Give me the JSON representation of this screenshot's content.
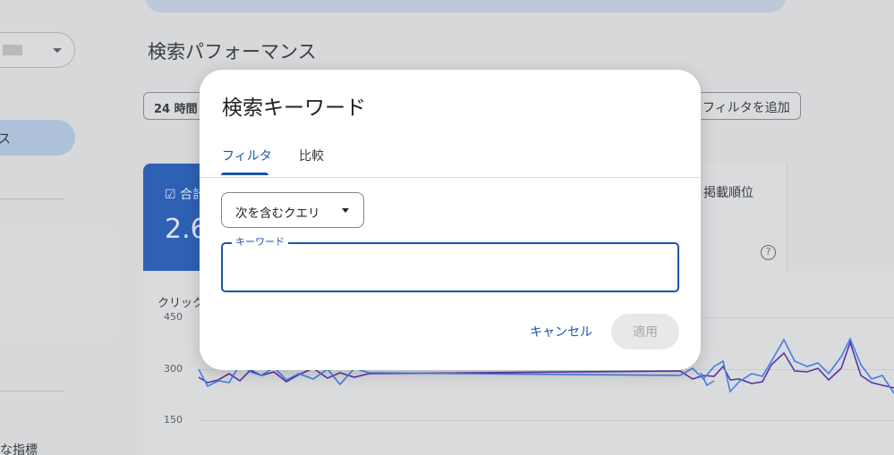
{
  "background": {
    "page_title": "検索パフォーマンス",
    "date_chip": "24 時間",
    "add_filter_chip": "フィルタを追加",
    "nav_active_label": "ス",
    "nav_bottom_label": "な指標",
    "metric_total_label": "合計",
    "metric_total_value": "2.6",
    "metric_position_label": "掲載順位",
    "chart_label": "クリック",
    "y_ticks": [
      "450",
      "300",
      "150"
    ]
  },
  "dialog": {
    "title": "検索キーワード",
    "tabs": [
      {
        "label": "フィルタ",
        "active": true
      },
      {
        "label": "比較",
        "active": false
      }
    ],
    "match_type_select": "次を含むクエリ",
    "keyword_field": {
      "label": "キーワード",
      "value": ""
    },
    "cancel_label": "キャンセル",
    "apply_label": "適用"
  },
  "colors": {
    "accent": "#1a56a8",
    "metric_blue": "#2f64bd",
    "line_clicks": "#4285f4",
    "line_impressions": "#5e35b1"
  }
}
